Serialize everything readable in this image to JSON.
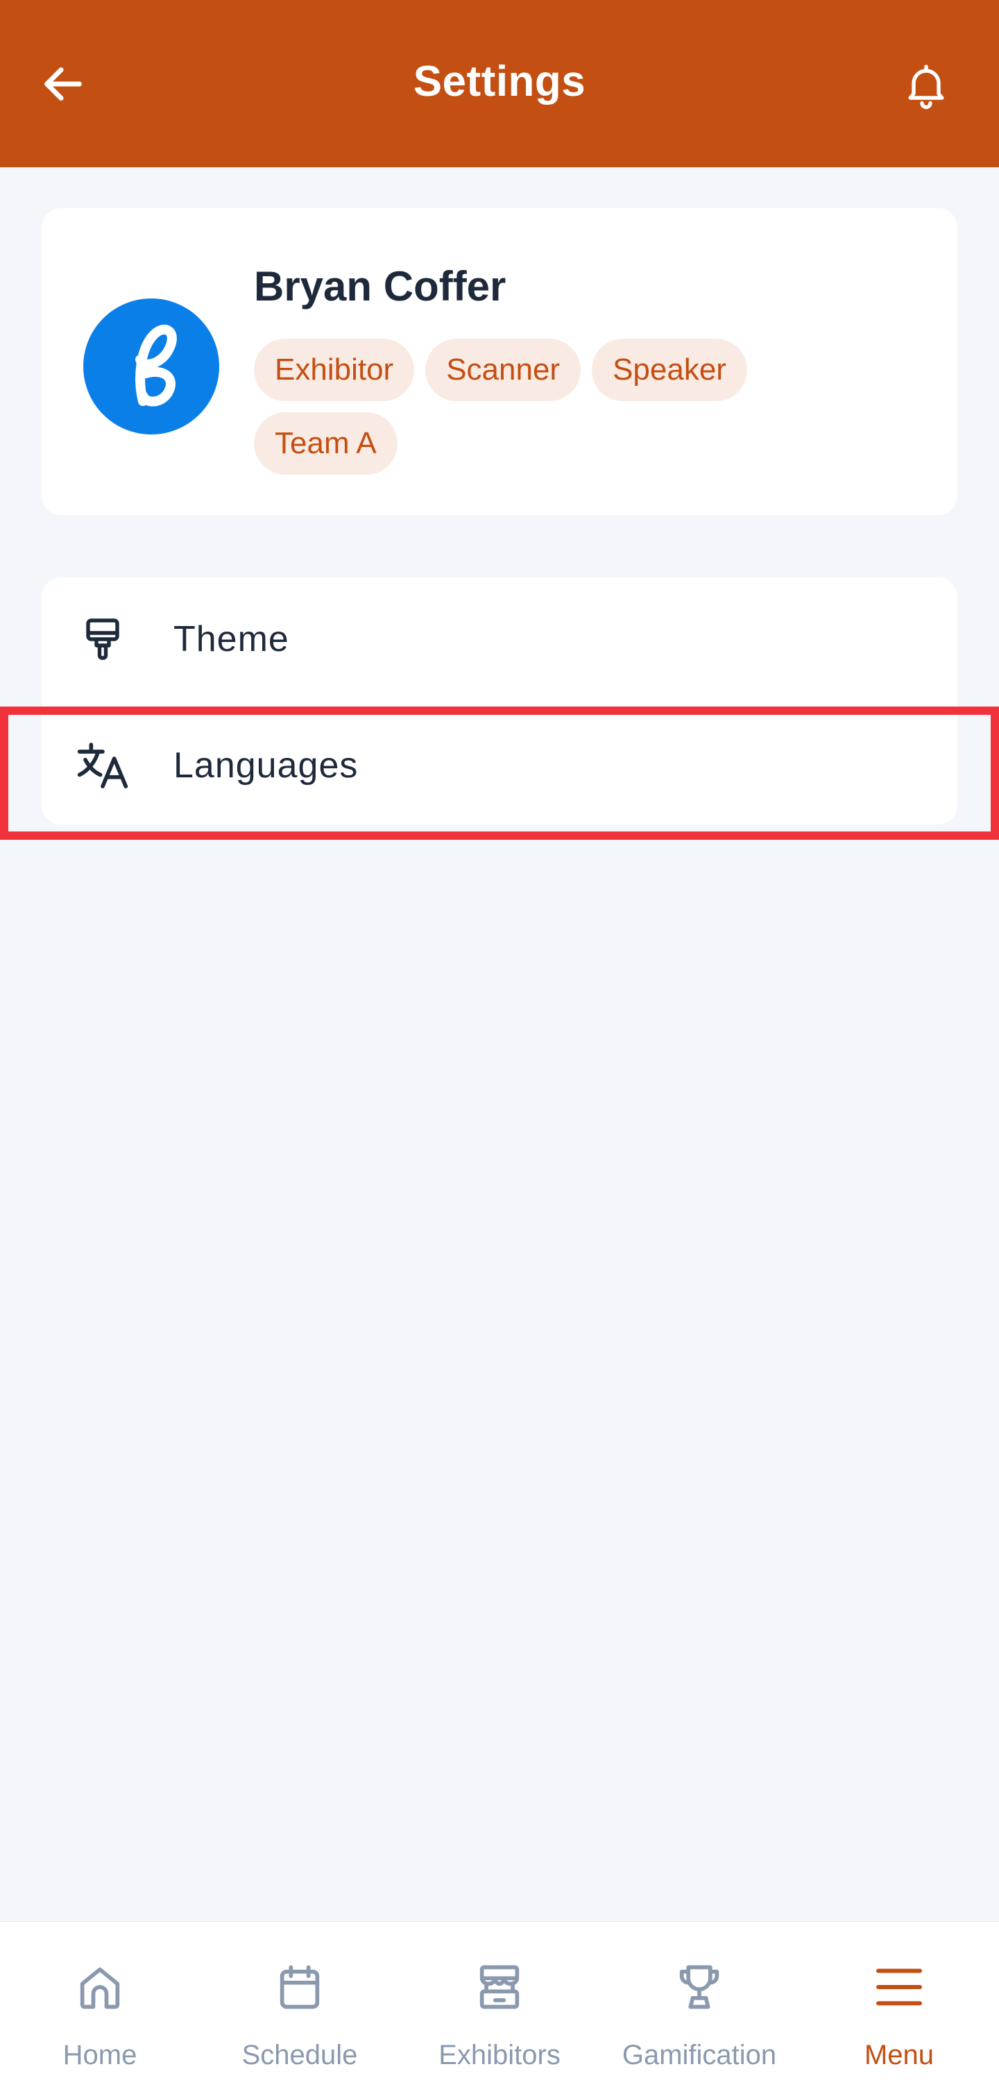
{
  "header": {
    "title": "Settings",
    "back_icon": "arrow-left-icon",
    "notification_icon": "bell-icon"
  },
  "profile": {
    "name": "Bryan Coffer",
    "avatar_icon": "script-b-logo",
    "tags": [
      "Exhibitor",
      "Scanner",
      "Speaker",
      "Team A"
    ]
  },
  "settings": {
    "items": [
      {
        "label": "Theme",
        "icon": "paint-brush-icon"
      },
      {
        "label": "Languages",
        "icon": "translate-icon",
        "highlighted": true
      }
    ]
  },
  "bottom_nav": {
    "items": [
      {
        "label": "Home",
        "icon": "home-icon"
      },
      {
        "label": "Schedule",
        "icon": "calendar-icon"
      },
      {
        "label": "Exhibitors",
        "icon": "storefront-icon"
      },
      {
        "label": "Gamification",
        "icon": "trophy-icon"
      },
      {
        "label": "Menu",
        "icon": "menu-icon",
        "active": true
      }
    ]
  },
  "colors": {
    "brand": "#c44f12",
    "background": "#f3f7fb",
    "text": "#1e2a3b",
    "chip_bg": "#f9ebe3",
    "nav_inactive": "#8a99ad",
    "avatar": "#0b7fe8",
    "highlight": "#f2323a"
  }
}
